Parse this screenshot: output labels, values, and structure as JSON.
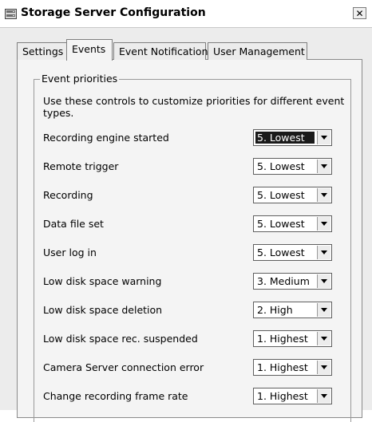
{
  "window": {
    "title": "Storage Server Configuration",
    "close_glyph": "✕"
  },
  "tabs": [
    {
      "label": "Settings",
      "active": false
    },
    {
      "label": "Events",
      "active": true
    },
    {
      "label": "Event Notification",
      "active": false
    },
    {
      "label": "User Management",
      "active": false
    }
  ],
  "group": {
    "title": "Event priorities",
    "description": "Use these controls to customize priorities for different event types."
  },
  "events": [
    {
      "label": "Recording engine started",
      "priority": "5. Lowest",
      "focused": true
    },
    {
      "label": "Remote trigger",
      "priority": "5. Lowest"
    },
    {
      "label": "Recording",
      "priority": "5. Lowest"
    },
    {
      "label": "Data file set",
      "priority": "5. Lowest"
    },
    {
      "label": "User log in",
      "priority": "5. Lowest"
    },
    {
      "label": "Low disk space warning",
      "priority": "3. Medium"
    },
    {
      "label": "Low disk space deletion",
      "priority": "2. High"
    },
    {
      "label": "Low disk space rec. suspended",
      "priority": "1. Highest"
    },
    {
      "label": "Camera Server connection error",
      "priority": "1. Highest"
    },
    {
      "label": "Change recording frame rate",
      "priority": "1. Highest"
    }
  ]
}
